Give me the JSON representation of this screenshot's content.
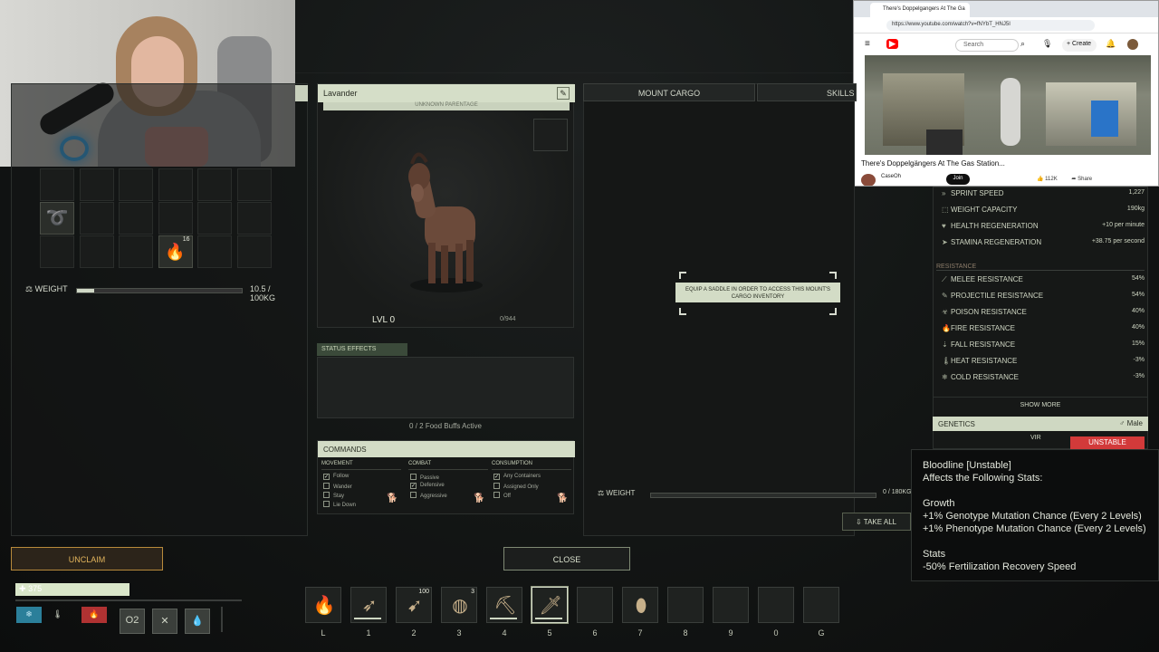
{
  "youtube": {
    "tab_title": "There's Doppelgangers At The Ga",
    "url": "https://www.youtube.com/watch?v=fNYbT_HNJ5I",
    "search_placeholder": "Search",
    "create_label": "Create",
    "video_title": "There's Doppelgängers At The Gas Station...",
    "channel": "CaseOh",
    "join_label": "Join",
    "likes": "112K",
    "share_label": "Share"
  },
  "inventory": {
    "weight_label": "WEIGHT",
    "weight_value": "10.5 / 100KG",
    "weight_fraction": 0.105,
    "slot_stack_count": "16"
  },
  "creature": {
    "name": "Lavander",
    "parentage": "UNKNOWN PARENTAGE",
    "level": "LVL 0",
    "xp": "0/944",
    "status_header": "STATUS EFFECTS",
    "food_buffs": "0 / 2 Food Buffs Active"
  },
  "commands": {
    "header": "COMMANDS",
    "columns": [
      {
        "title": "MOVEMENT",
        "items": [
          {
            "label": "Follow",
            "checked": true
          },
          {
            "label": "Wander",
            "checked": false
          },
          {
            "label": "Stay",
            "checked": false
          },
          {
            "label": "Lie Down",
            "checked": false
          }
        ]
      },
      {
        "title": "COMBAT",
        "items": [
          {
            "label": "Passive",
            "checked": false
          },
          {
            "label": "Defensive",
            "checked": true
          },
          {
            "label": "Aggressive",
            "checked": false
          }
        ]
      },
      {
        "title": "CONSUMPTION",
        "items": [
          {
            "label": "Any Containers",
            "checked": true
          },
          {
            "label": "Assigned Only",
            "checked": false
          },
          {
            "label": "Off",
            "checked": false
          }
        ]
      }
    ]
  },
  "cargo": {
    "tab_cargo": "MOUNT CARGO",
    "tab_skills": "SKILLS",
    "saddle_message": "EQUIP A SADDLE IN ORDER TO ACCESS THIS MOUNT'S CARGO INVENTORY",
    "weight_label": "WEIGHT",
    "weight_value": "0 / 180KG",
    "take_all": "TAKE ALL"
  },
  "stats": {
    "top": [
      {
        "label": "SPRINT SPEED",
        "value": "1,227"
      },
      {
        "label": "WEIGHT CAPACITY",
        "value": "190kg"
      },
      {
        "label": "HEALTH REGENERATION",
        "value": "+10 per minute"
      },
      {
        "label": "STAMINA REGENERATION",
        "value": "+38.75 per second"
      }
    ],
    "resistance_header": "RESISTANCE",
    "resistances": [
      {
        "label": "MELEE RESISTANCE",
        "value": "54%"
      },
      {
        "label": "PROJECTILE RESISTANCE",
        "value": "54%"
      },
      {
        "label": "POISON RESISTANCE",
        "value": "40%"
      },
      {
        "label": "FIRE RESISTANCE",
        "value": "40%"
      },
      {
        "label": "FALL RESISTANCE",
        "value": "15%"
      },
      {
        "label": "HEAT RESISTANCE",
        "value": "-3%"
      },
      {
        "label": "COLD RESISTANCE",
        "value": "-3%"
      }
    ],
    "show_more": "SHOW MORE",
    "genetics_label": "GENETICS",
    "sex": "Male",
    "vir": "VIR",
    "unstable": "UNSTABLE"
  },
  "tooltip": {
    "title": "Bloodline [Unstable]",
    "subtitle": "Affects the Following Stats:",
    "growth_header": "Growth",
    "growth_lines": [
      "+1% Genotype Mutation Chance (Every 2 Levels)",
      "+1% Phenotype Mutation Chance (Every 2 Levels)"
    ],
    "stats_header": "Stats",
    "stats_lines": [
      "-50% Fertilization Recovery Speed"
    ]
  },
  "buttons": {
    "unclaim": "UNCLAIM",
    "close": "CLOSE"
  },
  "hud": {
    "health": "375",
    "o2": "O2"
  },
  "hotbar": [
    {
      "key": "L",
      "icon": "torch-icon",
      "glyph": "🔥",
      "count": "",
      "durability": false,
      "selected": false
    },
    {
      "key": "1",
      "icon": "bow-icon",
      "glyph": "➶",
      "count": "",
      "durability": true,
      "selected": false
    },
    {
      "key": "2",
      "icon": "spear-icon",
      "glyph": "➹",
      "count": "100",
      "durability": false,
      "selected": false
    },
    {
      "key": "3",
      "icon": "bandage-icon",
      "glyph": "◍",
      "count": "3",
      "durability": false,
      "selected": false
    },
    {
      "key": "4",
      "icon": "pickaxe-icon",
      "glyph": "⛏",
      "count": "",
      "durability": true,
      "selected": false
    },
    {
      "key": "5",
      "icon": "knife-icon",
      "glyph": "🗡",
      "count": "",
      "durability": true,
      "selected": true
    },
    {
      "key": "6",
      "icon": "empty-slot-icon",
      "glyph": "",
      "count": "",
      "durability": false,
      "selected": false
    },
    {
      "key": "7",
      "icon": "waterskin-icon",
      "glyph": "⬮",
      "count": "",
      "durability": false,
      "selected": false
    },
    {
      "key": "8",
      "icon": "empty-slot-icon",
      "glyph": "",
      "count": "",
      "durability": false,
      "selected": false
    },
    {
      "key": "9",
      "icon": "empty-slot-icon",
      "glyph": "",
      "count": "",
      "durability": false,
      "selected": false
    },
    {
      "key": "0",
      "icon": "empty-slot-icon",
      "glyph": "",
      "count": "",
      "durability": false,
      "selected": false
    },
    {
      "key": "G",
      "icon": "empty-slot-icon",
      "glyph": "",
      "count": "",
      "durability": false,
      "selected": false
    }
  ]
}
